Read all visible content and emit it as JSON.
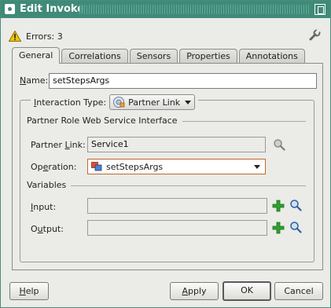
{
  "window": {
    "title": "Edit Invoke"
  },
  "errors": {
    "text": "Errors: 3"
  },
  "tabs": [
    {
      "label": "General",
      "active": true
    },
    {
      "label": "Correlations",
      "active": false
    },
    {
      "label": "Sensors",
      "active": false
    },
    {
      "label": "Properties",
      "active": false
    },
    {
      "label": "Annotations",
      "active": false
    }
  ],
  "general": {
    "name_label_mnemonic": "N",
    "name_label_rest": "ame:",
    "name_value": "setStepsArgs",
    "interaction_type_label_mnemonic": "I",
    "interaction_type_label_rest": "nteraction Type:",
    "interaction_type_value": "Partner Link",
    "section_interface": "Partner Role Web Service Interface",
    "partner_link_label_pre": "Partner ",
    "partner_link_label_mnemonic": "L",
    "partner_link_label_rest": "ink:",
    "partner_link_value": "Service1",
    "operation_label_pre": "Op",
    "operation_label_mnemonic": "e",
    "operation_label_rest": "ration:",
    "operation_value": "setStepsArgs",
    "section_variables": "Variables",
    "input_label_mnemonic": "I",
    "input_label_rest": "nput:",
    "input_value": "",
    "output_label_pre": "O",
    "output_label_mnemonic": "u",
    "output_label_rest": "tput:",
    "output_value": ""
  },
  "buttons": {
    "help_mnemonic": "H",
    "help_rest": "elp",
    "apply_pre": "",
    "apply_mnemonic": "A",
    "apply_rest": "pply",
    "ok": "OK",
    "cancel": "Cancel"
  },
  "colors": {
    "titlebar": "#3f8a78",
    "add_icon": "#2fa12f",
    "focus_border": "#c06a2a"
  }
}
